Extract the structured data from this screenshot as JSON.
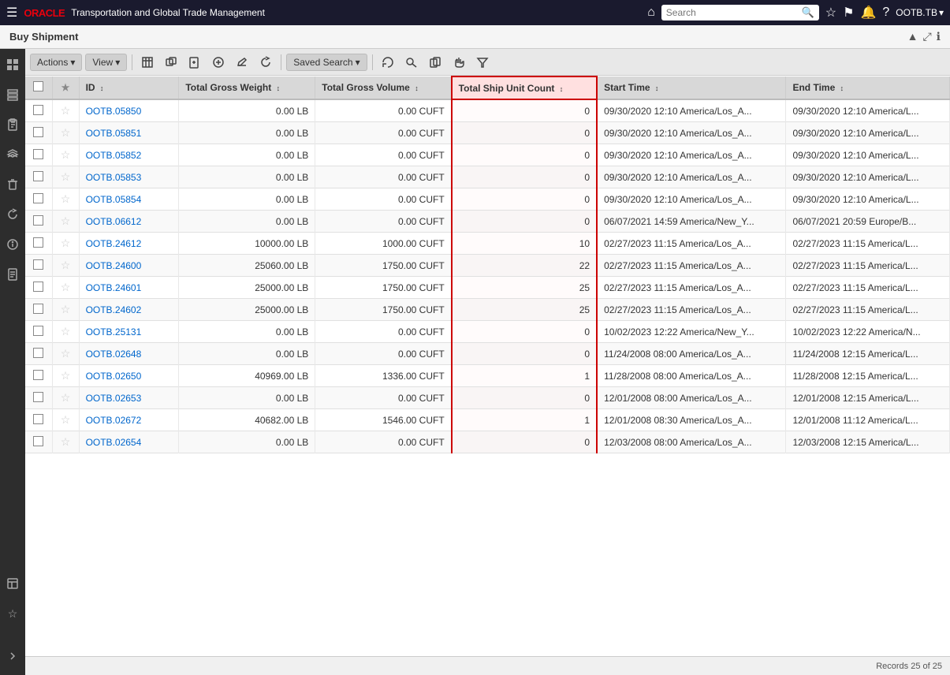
{
  "topnav": {
    "app_title": "Transportation and Global Trade Management",
    "search_placeholder": "Search",
    "user": "OOTB.TB",
    "home_icon": "⌂",
    "star_icon": "☆",
    "flag_icon": "⚑",
    "bell_icon": "🔔",
    "help_icon": "?",
    "chevron_icon": "▾",
    "hamburger": "☰"
  },
  "page": {
    "title": "Buy Shipment"
  },
  "toolbar": {
    "actions_label": "Actions",
    "view_label": "View",
    "saved_search_label": "Saved Search",
    "chevron": "▾"
  },
  "table": {
    "columns": [
      {
        "key": "checkbox",
        "label": ""
      },
      {
        "key": "star",
        "label": ""
      },
      {
        "key": "id",
        "label": "ID"
      },
      {
        "key": "gross_weight",
        "label": "Total Gross Weight"
      },
      {
        "key": "gross_volume",
        "label": "Total Gross Volume"
      },
      {
        "key": "ship_unit_count",
        "label": "Total Ship Unit Count"
      },
      {
        "key": "start_time",
        "label": "Start Time"
      },
      {
        "key": "end_time",
        "label": "End Time"
      }
    ],
    "rows": [
      {
        "id": "OOTB.05850",
        "gross_weight": "0.00 LB",
        "gross_volume": "0.00 CUFT",
        "ship_unit_count": "0",
        "start_time": "09/30/2020 12:10 America/Los_A...",
        "end_time": "09/30/2020 12:10 America/L...",
        "starred": false
      },
      {
        "id": "OOTB.05851",
        "gross_weight": "0.00 LB",
        "gross_volume": "0.00 CUFT",
        "ship_unit_count": "0",
        "start_time": "09/30/2020 12:10 America/Los_A...",
        "end_time": "09/30/2020 12:10 America/L...",
        "starred": false
      },
      {
        "id": "OOTB.05852",
        "gross_weight": "0.00 LB",
        "gross_volume": "0.00 CUFT",
        "ship_unit_count": "0",
        "start_time": "09/30/2020 12:10 America/Los_A...",
        "end_time": "09/30/2020 12:10 America/L...",
        "starred": false
      },
      {
        "id": "OOTB.05853",
        "gross_weight": "0.00 LB",
        "gross_volume": "0.00 CUFT",
        "ship_unit_count": "0",
        "start_time": "09/30/2020 12:10 America/Los_A...",
        "end_time": "09/30/2020 12:10 America/L...",
        "starred": false
      },
      {
        "id": "OOTB.05854",
        "gross_weight": "0.00 LB",
        "gross_volume": "0.00 CUFT",
        "ship_unit_count": "0",
        "start_time": "09/30/2020 12:10 America/Los_A...",
        "end_time": "09/30/2020 12:10 America/L...",
        "starred": false
      },
      {
        "id": "OOTB.06612",
        "gross_weight": "0.00 LB",
        "gross_volume": "0.00 CUFT",
        "ship_unit_count": "0",
        "start_time": "06/07/2021 14:59 America/New_Y...",
        "end_time": "06/07/2021 20:59 Europe/B...",
        "starred": false
      },
      {
        "id": "OOTB.24612",
        "gross_weight": "10000.00 LB",
        "gross_volume": "1000.00 CUFT",
        "ship_unit_count": "10",
        "start_time": "02/27/2023 11:15 America/Los_A...",
        "end_time": "02/27/2023 11:15 America/L...",
        "starred": false
      },
      {
        "id": "OOTB.24600",
        "gross_weight": "25060.00 LB",
        "gross_volume": "1750.00 CUFT",
        "ship_unit_count": "22",
        "start_time": "02/27/2023 11:15 America/Los_A...",
        "end_time": "02/27/2023 11:15 America/L...",
        "starred": false
      },
      {
        "id": "OOTB.24601",
        "gross_weight": "25000.00 LB",
        "gross_volume": "1750.00 CUFT",
        "ship_unit_count": "25",
        "start_time": "02/27/2023 11:15 America/Los_A...",
        "end_time": "02/27/2023 11:15 America/L...",
        "starred": false
      },
      {
        "id": "OOTB.24602",
        "gross_weight": "25000.00 LB",
        "gross_volume": "1750.00 CUFT",
        "ship_unit_count": "25",
        "start_time": "02/27/2023 11:15 America/Los_A...",
        "end_time": "02/27/2023 11:15 America/L...",
        "starred": false
      },
      {
        "id": "OOTB.25131",
        "gross_weight": "0.00 LB",
        "gross_volume": "0.00 CUFT",
        "ship_unit_count": "0",
        "start_time": "10/02/2023 12:22 America/New_Y...",
        "end_time": "10/02/2023 12:22 America/N...",
        "starred": false
      },
      {
        "id": "OOTB.02648",
        "gross_weight": "0.00 LB",
        "gross_volume": "0.00 CUFT",
        "ship_unit_count": "0",
        "start_time": "11/24/2008 08:00 America/Los_A...",
        "end_time": "11/24/2008 12:15 America/L...",
        "starred": false
      },
      {
        "id": "OOTB.02650",
        "gross_weight": "40969.00 LB",
        "gross_volume": "1336.00 CUFT",
        "ship_unit_count": "1",
        "start_time": "11/28/2008 08:00 America/Los_A...",
        "end_time": "11/28/2008 12:15 America/L...",
        "starred": false
      },
      {
        "id": "OOTB.02653",
        "gross_weight": "0.00 LB",
        "gross_volume": "0.00 CUFT",
        "ship_unit_count": "0",
        "start_time": "12/01/2008 08:00 America/Los_A...",
        "end_time": "12/01/2008 12:15 America/L...",
        "starred": false
      },
      {
        "id": "OOTB.02672",
        "gross_weight": "40682.00 LB",
        "gross_volume": "1546.00 CUFT",
        "ship_unit_count": "1",
        "start_time": "12/01/2008 08:30 America/Los_A...",
        "end_time": "12/01/2008 11:12 America/L...",
        "starred": false
      },
      {
        "id": "OOTB.02654",
        "gross_weight": "0.00 LB",
        "gross_volume": "0.00 CUFT",
        "ship_unit_count": "0",
        "start_time": "12/03/2008 08:00 America/Los_A...",
        "end_time": "12/03/2008 12:15 America/L...",
        "starred": false
      }
    ]
  },
  "status": {
    "records": "Records 25 of 25"
  }
}
